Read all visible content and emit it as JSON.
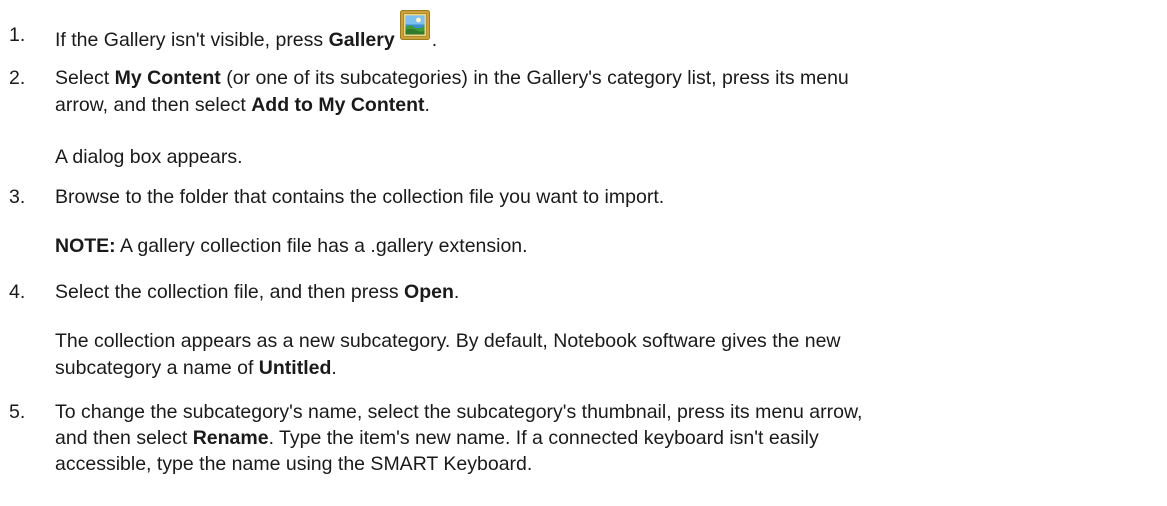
{
  "steps": [
    {
      "num": "1.",
      "text_before": "If the Gallery isn't visible, press ",
      "bold": "Gallery",
      "icon": "gallery-picture-icon",
      "text_after": "."
    },
    {
      "num": "2.",
      "l1_a": "Select ",
      "l1_b": "My Content",
      "l1_c": " (or one of its subcategories) in the Gallery's category list, press its menu",
      "l2_a": "arrow, and then select ",
      "l2_b": "Add to My Content",
      "l2_c": ".",
      "result": "A dialog box appears."
    },
    {
      "num": "3.",
      "text": "Browse to the folder that contains the collection file you want to import.",
      "note_label": "NOTE:",
      "note_text": " A gallery collection file has a .gallery extension."
    },
    {
      "num": "4.",
      "text_before": "Select the collection file, and then press ",
      "bold": "Open",
      "text_after": ".",
      "result_l1": "The collection appears as a new subcategory. By default, Notebook software gives the new",
      "result_l2_a": "subcategory a name of ",
      "result_l2_b": "Untitled",
      "result_l2_c": "."
    },
    {
      "num": "5.",
      "l1": "To change the subcategory's name, select the subcategory's thumbnail, press its menu arrow,",
      "l2_a": "and then select ",
      "l2_b": "Rename",
      "l2_c": ". Type the item's new name. If a connected keyboard isn't easily",
      "l3": "accessible, type the name using the SMART Keyboard."
    }
  ],
  "colors": {
    "text": "#1a1a1a",
    "icon_frame": "#c9a23a",
    "icon_sky": "#3a8fd0",
    "icon_land": "#3f9a3a"
  }
}
